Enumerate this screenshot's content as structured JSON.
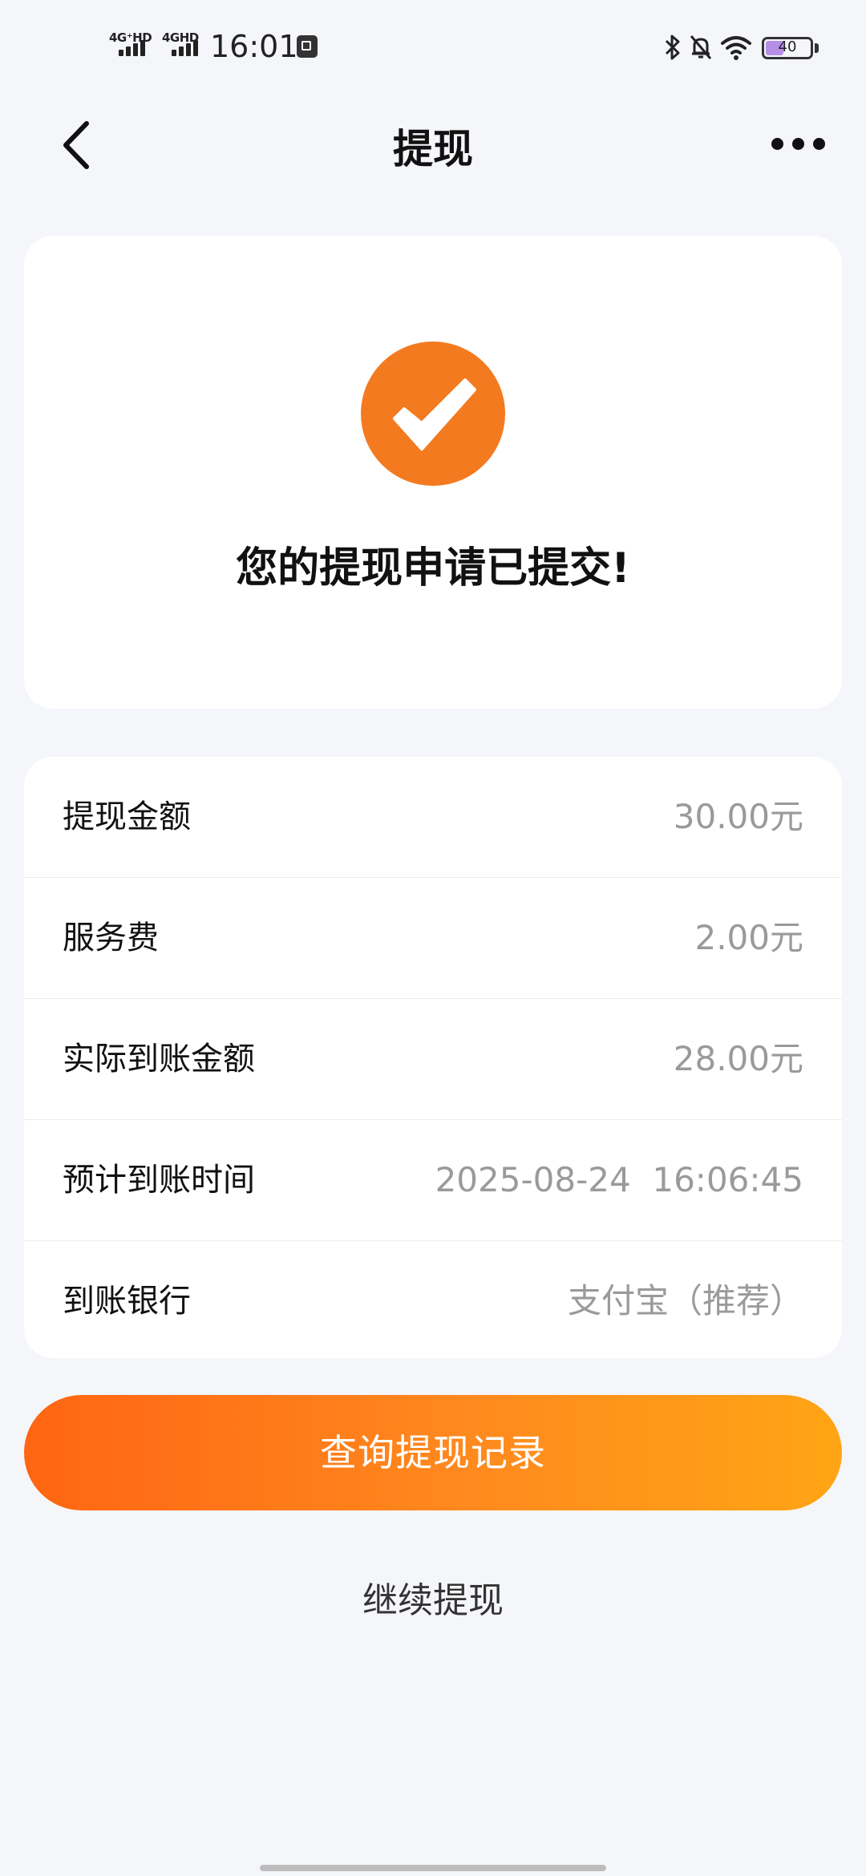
{
  "status_bar": {
    "sim1_label": "4G⁺HD",
    "sim2_label": "4GHD",
    "time": "16:01",
    "battery_level": "40",
    "icons": [
      "bluetooth-icon",
      "mute-icon",
      "wifi-icon",
      "battery-icon"
    ]
  },
  "nav": {
    "title": "提现",
    "back_icon": "chevron-left-icon",
    "more_icon": "more-dots-icon"
  },
  "result": {
    "icon": "check-circle-icon",
    "icon_color": "#f47a20",
    "message": "您的提现申请已提交!"
  },
  "details": [
    {
      "label": "提现金额",
      "value": "30.00元"
    },
    {
      "label": "服务费",
      "value": "2.00元"
    },
    {
      "label": "实际到账金额",
      "value": "28.00元"
    },
    {
      "label": "预计到账时间",
      "value": "2025-08-24  16:06:45"
    },
    {
      "label": "到账银行",
      "value": "支付宝（推荐）"
    }
  ],
  "actions": {
    "primary_label": "查询提现记录",
    "secondary_label": "继续提现",
    "primary_gradient": [
      "#ff6512",
      "#ffa514"
    ]
  }
}
